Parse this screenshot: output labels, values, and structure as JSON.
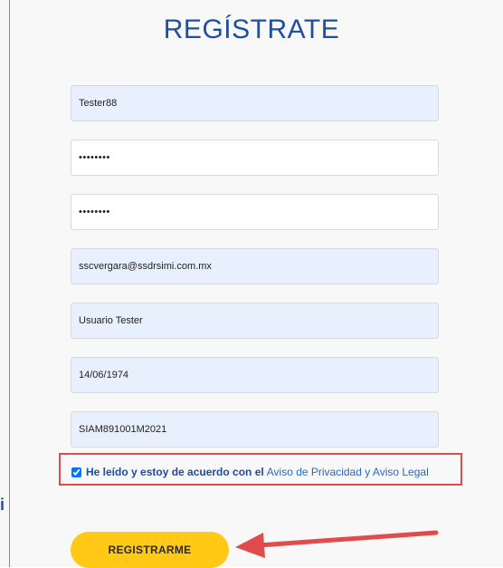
{
  "form": {
    "title": "REGÍSTRATE",
    "fields": [
      {
        "name": "username",
        "value": "Tester88"
      },
      {
        "name": "password",
        "value": "••••••••"
      },
      {
        "name": "confirm_password",
        "value": "••••••••"
      },
      {
        "name": "email",
        "value": "sscvergara@ssdrsimi.com.mx"
      },
      {
        "name": "full_name",
        "value": "Usuario Tester"
      },
      {
        "name": "birth_date",
        "value": "14/06/1974"
      },
      {
        "name": "rfc",
        "value": "SIAM891001M2021"
      }
    ],
    "consent": {
      "checked": true,
      "text": "He leído y estoy de acuerdo con el",
      "link": "Aviso de Privacidad y Aviso Legal"
    },
    "submit_label": "REGISTRARME"
  },
  "side_text": "i",
  "colors": {
    "title": "#1f4fa0",
    "autofill": "#e8f0fe",
    "highlight": "#e04b4b",
    "button": "#ffc915"
  }
}
